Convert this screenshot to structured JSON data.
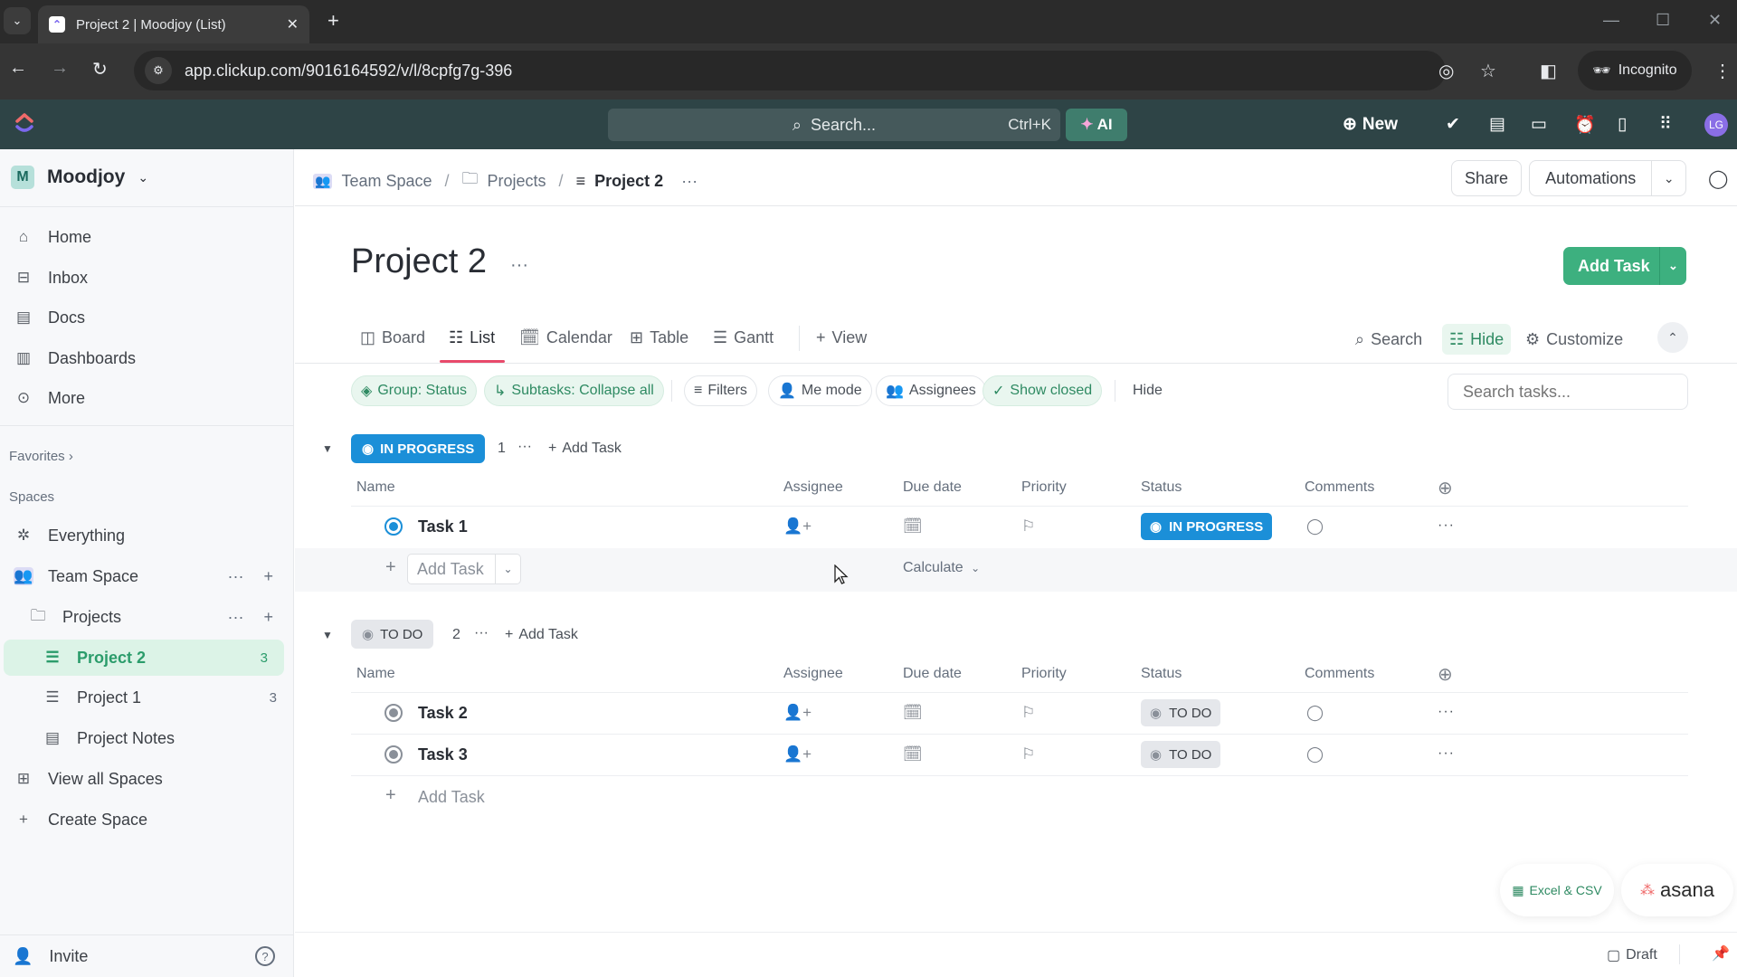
{
  "browser": {
    "tab_title": "Project 2 | Moodjoy (List)",
    "url": "app.clickup.com/9016164592/v/l/8cpfg7g-396",
    "incognito_label": "Incognito"
  },
  "app_header": {
    "search_placeholder": "Search...",
    "search_shortcut": "Ctrl+K",
    "ai_label": "AI",
    "new_label": "New",
    "avatar_initials": "LG"
  },
  "sidebar": {
    "workspace": {
      "initial": "M",
      "name": "Moodjoy"
    },
    "nav": [
      {
        "label": "Home",
        "icon": "home-icon"
      },
      {
        "label": "Inbox",
        "icon": "inbox-icon"
      },
      {
        "label": "Docs",
        "icon": "docs-icon"
      },
      {
        "label": "Dashboards",
        "icon": "dashboards-icon"
      },
      {
        "label": "More",
        "icon": "more-icon"
      }
    ],
    "favorites_label": "Favorites",
    "spaces_label": "Spaces",
    "spaces": [
      {
        "label": "Everything"
      },
      {
        "label": "Team Space"
      },
      {
        "label": "Projects"
      },
      {
        "label": "Project 2",
        "count": "3",
        "active": true
      },
      {
        "label": "Project 1",
        "count": "3"
      },
      {
        "label": "Project Notes"
      },
      {
        "label": "View all Spaces"
      },
      {
        "label": "Create Space"
      }
    ],
    "invite_label": "Invite"
  },
  "topbar": {
    "breadcrumb": [
      "Team Space",
      "Projects",
      "Project 2"
    ],
    "share_label": "Share",
    "automations_label": "Automations"
  },
  "page": {
    "title": "Project 2",
    "add_task_label": "Add Task"
  },
  "views": {
    "tabs": [
      "Board",
      "List",
      "Calendar",
      "Table",
      "Gantt"
    ],
    "active_tab": "List",
    "add_view_label": "View",
    "search_label": "Search",
    "hide_label": "Hide",
    "customize_label": "Customize"
  },
  "filters": {
    "group": "Group: Status",
    "subtasks": "Subtasks: Collapse all",
    "filters": "Filters",
    "me_mode": "Me mode",
    "assignees": "Assignees",
    "show_closed": "Show closed",
    "hide": "Hide",
    "search_placeholder": "Search tasks..."
  },
  "columns": [
    "Name",
    "Assignee",
    "Due date",
    "Priority",
    "Status",
    "Comments"
  ],
  "groups": [
    {
      "status": "IN PROGRESS",
      "count": "1",
      "add_label": "Add Task",
      "tasks": [
        {
          "name": "Task 1",
          "status": "IN PROGRESS"
        }
      ],
      "inline_add_label": "Add Task",
      "calculate_label": "Calculate"
    },
    {
      "status": "TO DO",
      "count": "2",
      "add_label": "Add Task",
      "tasks": [
        {
          "name": "Task 2",
          "status": "TO DO"
        },
        {
          "name": "Task 3",
          "status": "TO DO"
        }
      ],
      "inline_add_label": "Add Task"
    }
  ],
  "imports": {
    "excel_label": "Excel & CSV",
    "asana_label": "asana"
  },
  "footer": {
    "draft_label": "Draft"
  },
  "colors": {
    "brand_green": "#3db07f",
    "in_progress": "#1b8fd8",
    "todo": "#e5e7eb",
    "header_bg": "#2e4446"
  }
}
